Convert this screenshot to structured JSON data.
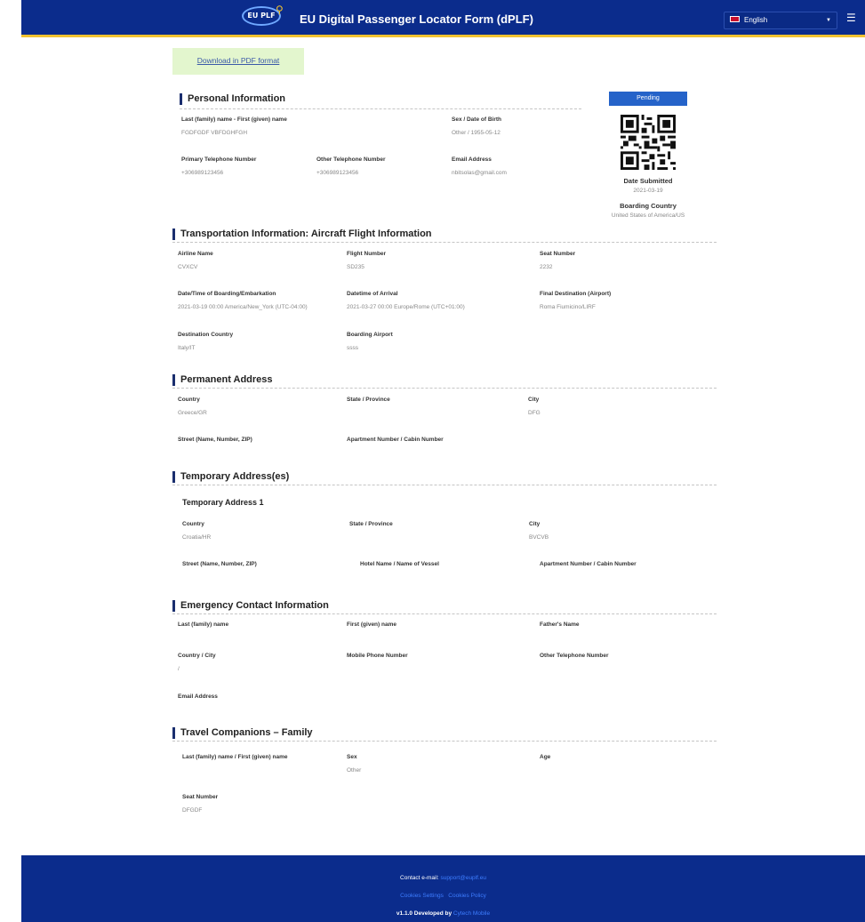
{
  "header": {
    "logo_text": "EU PLF",
    "title": "EU Digital Passenger Locator Form (dPLF)",
    "language": "English"
  },
  "download_pdf": "Download in PDF format",
  "status": "Pending",
  "personal": {
    "title": "Personal Information",
    "name_label": "Last (family) name - First (given) name",
    "name_value": "FGDFGDF VBFDGHFGH",
    "sexdob_label": "Sex / Date of Birth",
    "sexdob_value": "Other / 1955-05-12",
    "primary_phone_label": "Primary Telephone Number",
    "primary_phone_value": "+306989123456",
    "other_phone_label": "Other Telephone Number",
    "other_phone_value": "+306989123456",
    "email_label": "Email Address",
    "email_value": "nbitsolas@gmail.com",
    "date_submitted_label": "Date Submitted",
    "date_submitted_value": "2021-03-19",
    "boarding_country_label": "Boarding Country",
    "boarding_country_value": "United States of America/US"
  },
  "transport": {
    "title": "Transportation Information: Aircraft Flight Information",
    "airline_label": "Airline Name",
    "airline_value": "CVXCV",
    "flight_label": "Flight Number",
    "flight_value": "SD235",
    "seat_label": "Seat Number",
    "seat_value": "2232",
    "boarding_time_label": "Date/Time of Boarding/Embarkation",
    "boarding_time_value": "2021-03-19 00:00 America/New_York (UTC-04:00)",
    "arrival_label": "Datetime of Arrival",
    "arrival_value": "2021-03-27 00:00 Europe/Rome (UTC+01:00)",
    "final_dest_label": "Final Destination (Airport)",
    "final_dest_value": "Roma Fiumicino/LIRF",
    "dest_country_label": "Destination Country",
    "dest_country_value": "Italy/IT",
    "boarding_airport_label": "Boarding Airport",
    "boarding_airport_value": "ssss"
  },
  "permanent": {
    "title": "Permanent Address",
    "country_label": "Country",
    "country_value": "Greece/GR",
    "state_label": "State / Province",
    "city_label": "City",
    "city_value": "DFG",
    "street_label": "Street (Name, Number, ZIP)",
    "apartment_label": "Apartment Number / Cabin Number"
  },
  "temporary": {
    "title": "Temporary Address(es)",
    "sub_title": "Temporary Address 1",
    "country_label": "Country",
    "country_value": "Croatia/HR",
    "state_label": "State / Province",
    "city_label": "City",
    "city_value": "BVCVB",
    "street_label": "Street (Name, Number, ZIP)",
    "hotel_label": "Hotel Name / Name of Vessel",
    "apartment_label": "Apartment Number / Cabin Number"
  },
  "emergency": {
    "title": "Emergency Contact Information",
    "last_name_label": "Last (family) name",
    "first_name_label": "First (given) name",
    "father_label": "Father's Name",
    "country_city_label": "Country / City",
    "country_city_value": "/",
    "mobile_label": "Mobile Phone Number",
    "other_phone_label": "Other Telephone Number",
    "email_label": "Email Address"
  },
  "companions": {
    "title": "Travel Companions – Family",
    "name_label": "Last (family) name / First (given) name",
    "sex_label": "Sex",
    "sex_value": "Other",
    "age_label": "Age",
    "seat_label": "Seat Number",
    "seat_value": "DFGDF"
  },
  "footer": {
    "contact_label": "Contact e-mail:",
    "contact_email": "support@euplf.eu",
    "cookies_settings": "Cookies Settings",
    "cookies_policy": "Cookies Policy",
    "version": "v1.1.0 Developed by",
    "developer": "Cytech Mobile"
  },
  "colors": {
    "header_bg": "#0b2c8c",
    "accent_yellow": "#f2c230",
    "pending_blue": "#2563c9",
    "pdf_box_bg": "#e3f6ce"
  }
}
